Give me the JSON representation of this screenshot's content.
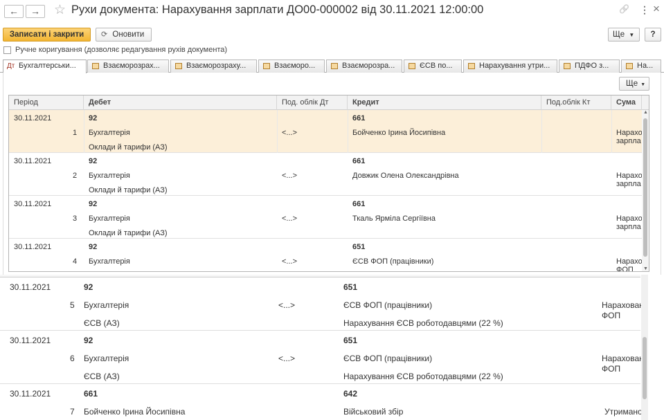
{
  "window": {
    "title": "Рухи документа: Нарахування зарплати ДО00-000002 від 30.11.2021 12:00:00",
    "back_glyph": "←",
    "forward_glyph": "→",
    "star_glyph": "☆",
    "link_glyph": "🔗",
    "more_glyph": "⋮",
    "close_glyph": "×"
  },
  "toolbar": {
    "save_close": "Записати і закрити",
    "refresh": "Оновити",
    "refresh_glyph": "⟳",
    "more": "Ще",
    "help": "?"
  },
  "manual_edit_label": "Ручне коригування (дозволяє редагування рухів документа)",
  "tabs": [
    {
      "label": "Бухгалтерськи..."
    },
    {
      "label": "Взаєморозрах..."
    },
    {
      "label": "Взаєморозраху..."
    },
    {
      "label": "Взаєморо..."
    },
    {
      "label": "Взаєморозра..."
    },
    {
      "label": "ЄСВ по..."
    },
    {
      "label": "Нарахування утри..."
    },
    {
      "label": "ПДФО з..."
    },
    {
      "label": "На..."
    }
  ],
  "active_tab_icon": "Дт",
  "grid_more": "Ще",
  "columns": {
    "period": "Період",
    "debit": "Дебет",
    "sub_dt": "Под. облік Дт",
    "credit": "Кредит",
    "sub_kt": "Под.облік Кт",
    "sum": "Сума"
  },
  "grid_rows": [
    {
      "date": "30.11.2021",
      "num": "1",
      "dt": "92",
      "dt2": "Бухгалтерія",
      "dt3": "Оклади й тарифи (АЗ)",
      "subdt": "<...>",
      "kt": "661",
      "kt2": "Бойченко Ірина Йосипівна",
      "kt3": "",
      "sum1": "Нарахо",
      "sum2": "зарпла"
    },
    {
      "date": "30.11.2021",
      "num": "2",
      "dt": "92",
      "dt2": "Бухгалтерія",
      "dt3": "Оклади й тарифи (АЗ)",
      "subdt": "<...>",
      "kt": "661",
      "kt2": "Довжик Олена Олександрівна",
      "kt3": "",
      "sum1": "Нарахо",
      "sum2": "зарпла"
    },
    {
      "date": "30.11.2021",
      "num": "3",
      "dt": "92",
      "dt2": "Бухгалтерія",
      "dt3": "Оклади й тарифи (АЗ)",
      "subdt": "<...>",
      "kt": "661",
      "kt2": "Ткаль Ярміла Сергіївна",
      "kt3": "",
      "sum1": "Нарахо",
      "sum2": "зарпла"
    },
    {
      "date": "30.11.2021",
      "num": "4",
      "dt": "92",
      "dt2": "Бухгалтерія",
      "dt3": "",
      "subdt": "<...>",
      "kt": "651",
      "kt2": "ЄСВ ФОП (працівники)",
      "kt3": "",
      "sum1": "Нарахо",
      "sum2": "ФОП"
    }
  ],
  "lower_rows": [
    {
      "date": "30.11.2021",
      "num": "5",
      "dt": "92",
      "dt2": "Бухгалтерія",
      "dt3": "ЄСВ (АЗ)",
      "subdt": "<...>",
      "kt": "651",
      "kt2": "ЄСВ ФОП (працівники)",
      "kt3": "Нарахування ЄСВ роботодавцями (22 %)",
      "sum1": "Нарахован",
      "sum2": "ФОП"
    },
    {
      "date": "30.11.2021",
      "num": "6",
      "dt": "92",
      "dt2": "Бухгалтерія",
      "dt3": "ЄСВ (АЗ)",
      "subdt": "<...>",
      "kt": "651",
      "kt2": "ЄСВ ФОП (працівники)",
      "kt3": "Нарахування ЄСВ роботодавцями (22 %)",
      "sum1": "Нарахован",
      "sum2": "ФОП"
    },
    {
      "date": "30.11.2021",
      "num": "7",
      "dt": "661",
      "dt2": "Бойченко Ірина Йосипівна",
      "dt3": "",
      "subdt": "",
      "kt": "642",
      "kt2": "Військовий збір",
      "kt3": "",
      "sum1": "Утримано",
      "sum2": ""
    }
  ]
}
